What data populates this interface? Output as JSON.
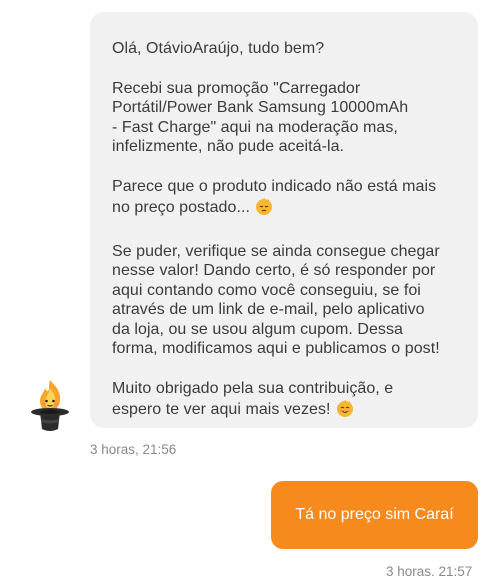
{
  "incoming_message": {
    "paragraphs": [
      "Olá, OtávioAraújo, tudo bem?",
      "Recebi sua promoção \"Carregador\nPortátil/Power Bank Samsung 10000mAh\n- Fast Charge\" aqui na moderação mas,\ninfelizmente, não pude aceitá-la.",
      "Parece que o produto indicado não está mais\nno preço postado...",
      "Se puder, verifique se ainda consegue chegar\nnesse valor! Dando certo, é só responder por\naqui contando como você conseguiu, se foi\natravés de um link de e-mail, pelo aplicativo\nda loja, ou se usou algum cupom. Dessa\nforma, modificamos aqui e publicamos o post!",
      "Muito obrigado pela sua contribuição, e\nespero te ver aqui mais vezes!"
    ],
    "timestamp": "3 horas, 21:56",
    "emojis": [
      "pensive-face",
      "smiling-face"
    ]
  },
  "outgoing_message": {
    "text": "Tá no preço sim Caraí",
    "timestamp": "3 horas, 21:57"
  },
  "avatar": {
    "icon": "flame-in-top-hat-icon"
  },
  "colors": {
    "incoming_bubble": "#f1f1f1",
    "outgoing_bubble": "#f78a1d",
    "message_text": "#3b3b3b",
    "timestamp": "#8a8a8a"
  }
}
